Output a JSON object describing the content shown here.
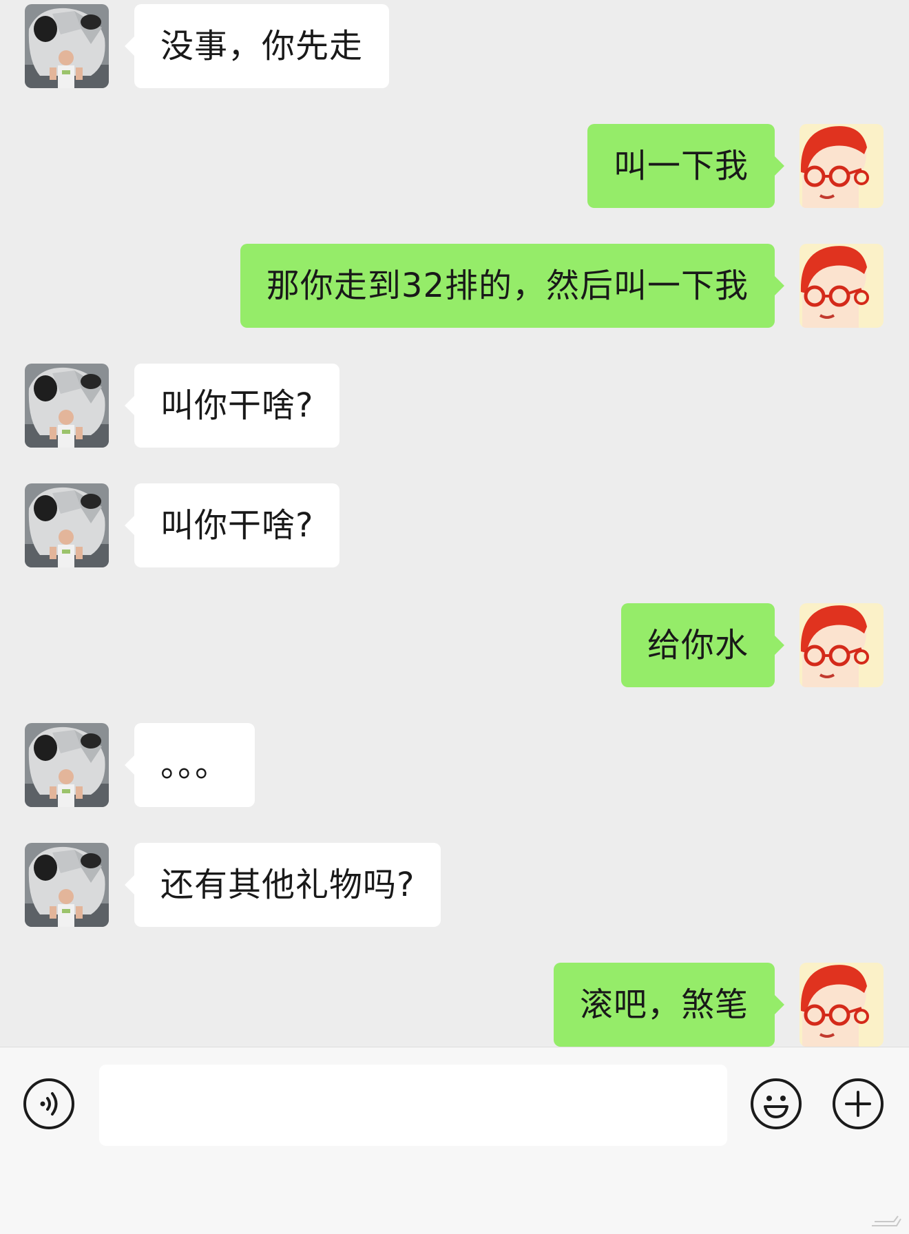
{
  "messages": [
    {
      "side": "in",
      "text": "没事，你先走"
    },
    {
      "side": "out",
      "text": "叫一下我"
    },
    {
      "side": "out",
      "text": "那你走到32排的，然后叫一下我"
    },
    {
      "side": "in",
      "text": "叫你干啥?"
    },
    {
      "side": "in",
      "text": "叫你干啥?"
    },
    {
      "side": "out",
      "text": "给你水"
    },
    {
      "side": "in",
      "text": "。。。"
    },
    {
      "side": "in",
      "text": "还有其他礼物吗?"
    },
    {
      "side": "out",
      "text": "滚吧，煞笔"
    }
  ],
  "input": {
    "value": "",
    "placeholder": ""
  },
  "icons": {
    "voice": "voice-icon",
    "emoji": "emoji-icon",
    "plus": "plus-icon",
    "incoming_avatar": "panda-sculpture-avatar",
    "outgoing_avatar": "red-hair-glasses-cartoon-avatar"
  },
  "colors": {
    "background": "#ededed",
    "incoming_bubble": "#ffffff",
    "outgoing_bubble": "#95ec69",
    "text": "#191919",
    "input_bar": "#f7f7f7"
  }
}
